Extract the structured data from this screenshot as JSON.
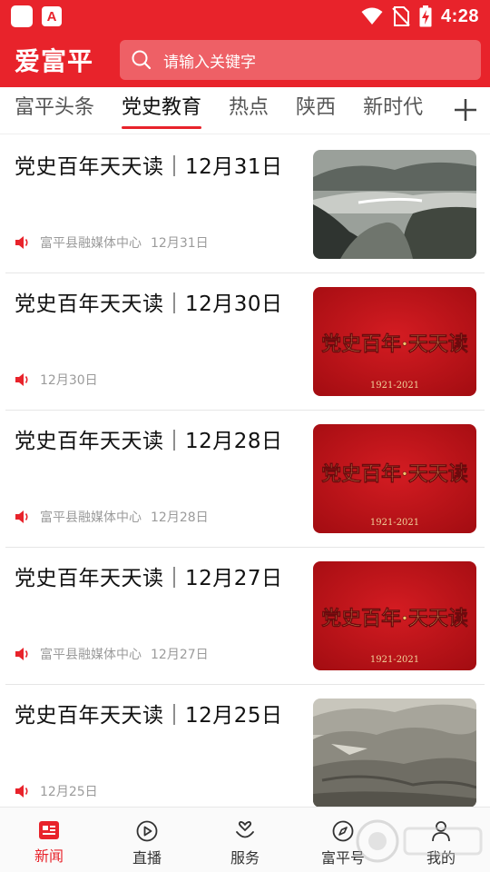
{
  "status_bar": {
    "time": "4:28",
    "app_icon_letter": "A"
  },
  "header": {
    "logo": "爱富平",
    "search_placeholder": "请输入关键字"
  },
  "tabs": [
    {
      "label": "富平头条",
      "active": false
    },
    {
      "label": "党史教育",
      "active": true
    },
    {
      "label": "热点",
      "active": false
    },
    {
      "label": "陕西",
      "active": false
    },
    {
      "label": "新时代",
      "active": false
    }
  ],
  "articles": [
    {
      "title": "党史百年天天读｜12月31日",
      "source": "富平县融媒体中心",
      "date": "12月31日",
      "thumb": "photo-landscape"
    },
    {
      "title": "党史百年天天读｜12月30日",
      "source": "",
      "date": "12月30日",
      "thumb": "banner"
    },
    {
      "title": "党史百年天天读｜12月28日",
      "source": "富平县融媒体中心",
      "date": "12月28日",
      "thumb": "banner"
    },
    {
      "title": "党史百年天天读｜12月27日",
      "source": "富平县融媒体中心",
      "date": "12月27日",
      "thumb": "banner"
    },
    {
      "title": "党史百年天天读｜12月25日",
      "source": "",
      "date": "12月25日",
      "thumb": "photo-hills"
    }
  ],
  "banner": {
    "text": "党史百年·天天读",
    "years": "1921-2021"
  },
  "bottom_nav": [
    {
      "label": "新闻",
      "icon": "news-icon",
      "active": true
    },
    {
      "label": "直播",
      "icon": "play-icon",
      "active": false
    },
    {
      "label": "服务",
      "icon": "service-icon",
      "active": false
    },
    {
      "label": "富平号",
      "icon": "compass-icon",
      "active": false
    },
    {
      "label": "我的",
      "icon": "person-icon",
      "active": false
    }
  ],
  "colors": {
    "brand_red": "#e8232b"
  }
}
